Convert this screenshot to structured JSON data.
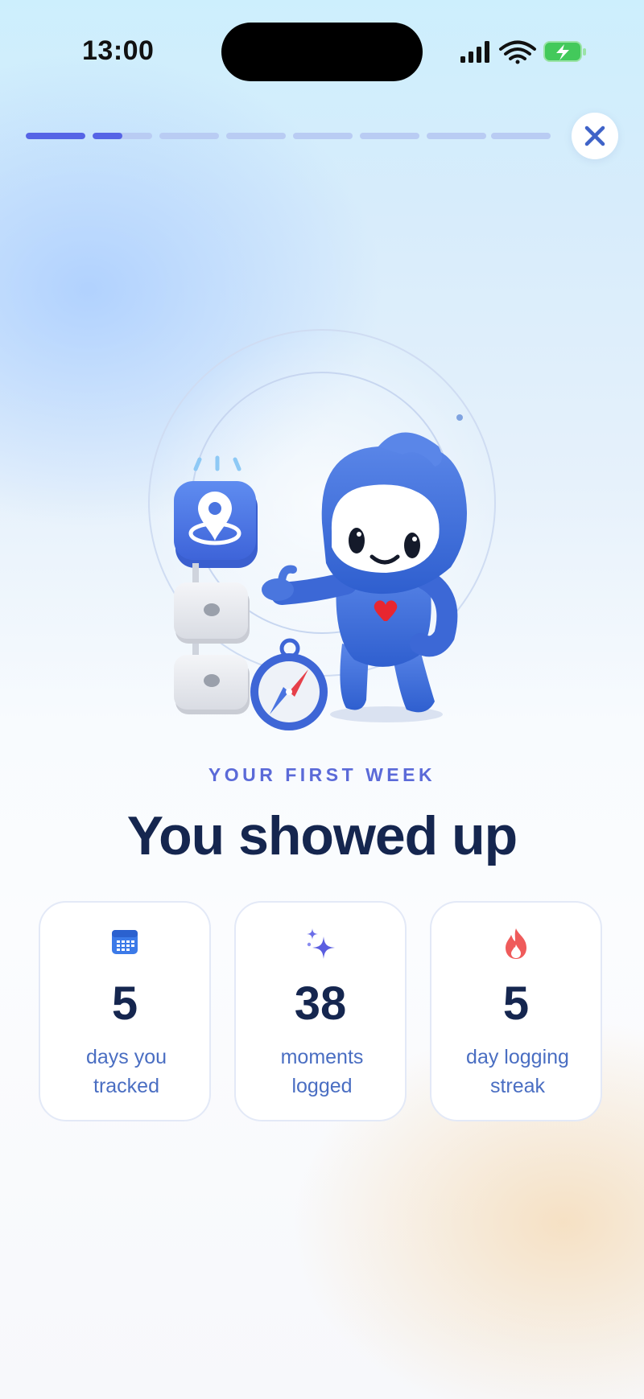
{
  "status_bar": {
    "time": "13:00"
  },
  "progress": {
    "total_steps": 8,
    "current_step": 2,
    "current_step_fill": 0.5
  },
  "header": {
    "close_label": "Close"
  },
  "hero": {
    "eyebrow": "YOUR FIRST WEEK",
    "title": "You showed up"
  },
  "stats": [
    {
      "icon": "calendar-icon",
      "value": "5",
      "label_line1": "days you",
      "label_line2": "tracked"
    },
    {
      "icon": "sparkles-icon",
      "value": "38",
      "label_line1": "moments",
      "label_line2": "logged"
    },
    {
      "icon": "flame-icon",
      "value": "5",
      "label_line1": "day logging",
      "label_line2": "streak"
    }
  ],
  "colors": {
    "accent": "#5664e6",
    "title": "#15264f",
    "label": "#4a6ec2",
    "mascot": "#3f6fd8",
    "heart": "#e8262f",
    "flame": "#ef5b5b"
  }
}
